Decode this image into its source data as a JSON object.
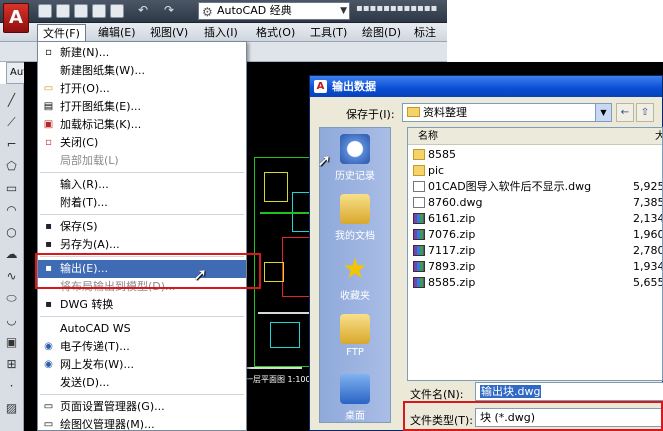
{
  "app": {
    "logo_letter": "A",
    "workspace": "AutoCAD 经典",
    "title_more": "▪▪▪▪▪▪▪▪▪▪▪▪"
  },
  "menubar": [
    "文件(F)",
    "编辑(E)",
    "视图(V)",
    "插入(I)",
    "格式(O)",
    "工具(T)",
    "绘图(D)",
    "标注"
  ],
  "ribbon_tab": "Auto",
  "file_menu": {
    "items": [
      {
        "label": "新建(N)...",
        "icon": "new-file-icon",
        "glyph": "▫",
        "disabled": false
      },
      {
        "label": "新建图纸集(W)...",
        "icon": "",
        "glyph": "",
        "disabled": false
      },
      {
        "label": "打开(O)...",
        "icon": "open-folder-icon",
        "glyph": "▭",
        "disabled": false
      },
      {
        "label": "打开图纸集(E)...",
        "icon": "open-sheetset-icon",
        "glyph": "▤",
        "disabled": false
      },
      {
        "label": "加载标记集(K)...",
        "icon": "markup-icon",
        "glyph": "▣",
        "disabled": false
      },
      {
        "label": "关闭(C)",
        "icon": "close-file-icon",
        "glyph": "▫",
        "disabled": false
      },
      {
        "label": "局部加载(L)",
        "icon": "",
        "glyph": "",
        "disabled": true
      },
      {
        "label": "输入(R)...",
        "icon": "",
        "glyph": "",
        "disabled": false
      },
      {
        "label": "附着(T)...",
        "icon": "",
        "glyph": "",
        "disabled": false
      },
      {
        "label": "保存(S)",
        "icon": "save-icon",
        "glyph": "▪",
        "disabled": false
      },
      {
        "label": "另存为(A)...",
        "icon": "save-as-icon",
        "glyph": "▪",
        "disabled": false
      },
      {
        "label": "输出(E)...",
        "icon": "export-icon",
        "glyph": "▪",
        "disabled": false
      },
      {
        "label": "将布局输出到模型(D)...",
        "icon": "",
        "glyph": "",
        "disabled": true
      },
      {
        "label": "DWG 转换",
        "icon": "dwg-convert-icon",
        "glyph": "▪",
        "disabled": false
      },
      {
        "label": "AutoCAD WS",
        "icon": "",
        "glyph": "",
        "disabled": false
      },
      {
        "label": "电子传递(T)...",
        "icon": "etransmit-icon",
        "glyph": "◉",
        "disabled": false
      },
      {
        "label": "网上发布(W)...",
        "icon": "publish-web-icon",
        "glyph": "◉",
        "disabled": false
      },
      {
        "label": "发送(D)...",
        "icon": "",
        "glyph": "",
        "disabled": false
      },
      {
        "label": "页面设置管理器(G)...",
        "icon": "page-setup-icon",
        "glyph": "▭",
        "disabled": false
      },
      {
        "label": "绘图仪管理器(M)...",
        "icon": "plotter-icon",
        "glyph": "▭",
        "disabled": false
      }
    ]
  },
  "dialog": {
    "title": "输出数据",
    "save_in_label": "保存于(I):",
    "save_in_value": "资料整理",
    "places": [
      {
        "label": "历史记录",
        "icon": "history-icon"
      },
      {
        "label": "我的文档",
        "icon": "my-documents-icon"
      },
      {
        "label": "收藏夹",
        "icon": "favorites-icon"
      },
      {
        "label": "FTP",
        "icon": "ftp-icon"
      },
      {
        "label": "桌面",
        "icon": "desktop-icon"
      }
    ],
    "columns": {
      "name": "名称",
      "size": "大"
    },
    "files": [
      {
        "name": "8585",
        "size": "",
        "kind": "folder"
      },
      {
        "name": "pic",
        "size": "",
        "kind": "folder"
      },
      {
        "name": "01CAD图导入软件后不显示.dwg",
        "size": "5,925",
        "kind": "dwg"
      },
      {
        "name": "8760.dwg",
        "size": "7,385",
        "kind": "dwg"
      },
      {
        "name": "6161.zip",
        "size": "2,134",
        "kind": "zip"
      },
      {
        "name": "7076.zip",
        "size": "1,960",
        "kind": "zip"
      },
      {
        "name": "7117.zip",
        "size": "2,780",
        "kind": "zip"
      },
      {
        "name": "7893.zip",
        "size": "1,934",
        "kind": "zip"
      },
      {
        "name": "8585.zip",
        "size": "5,655",
        "kind": "zip"
      }
    ],
    "filename_label": "文件名(N):",
    "filename_value": "输出块.dwg",
    "filetype_label": "文件类型(T):",
    "filetype_value": "块 (*.dwg)"
  },
  "drawing_caption": "一层平面图 1:100",
  "colors": {
    "highlight_red": "#d7191c",
    "menu_selected": "#3f6bb5",
    "xp_title_blue": "#0a4ed4"
  }
}
